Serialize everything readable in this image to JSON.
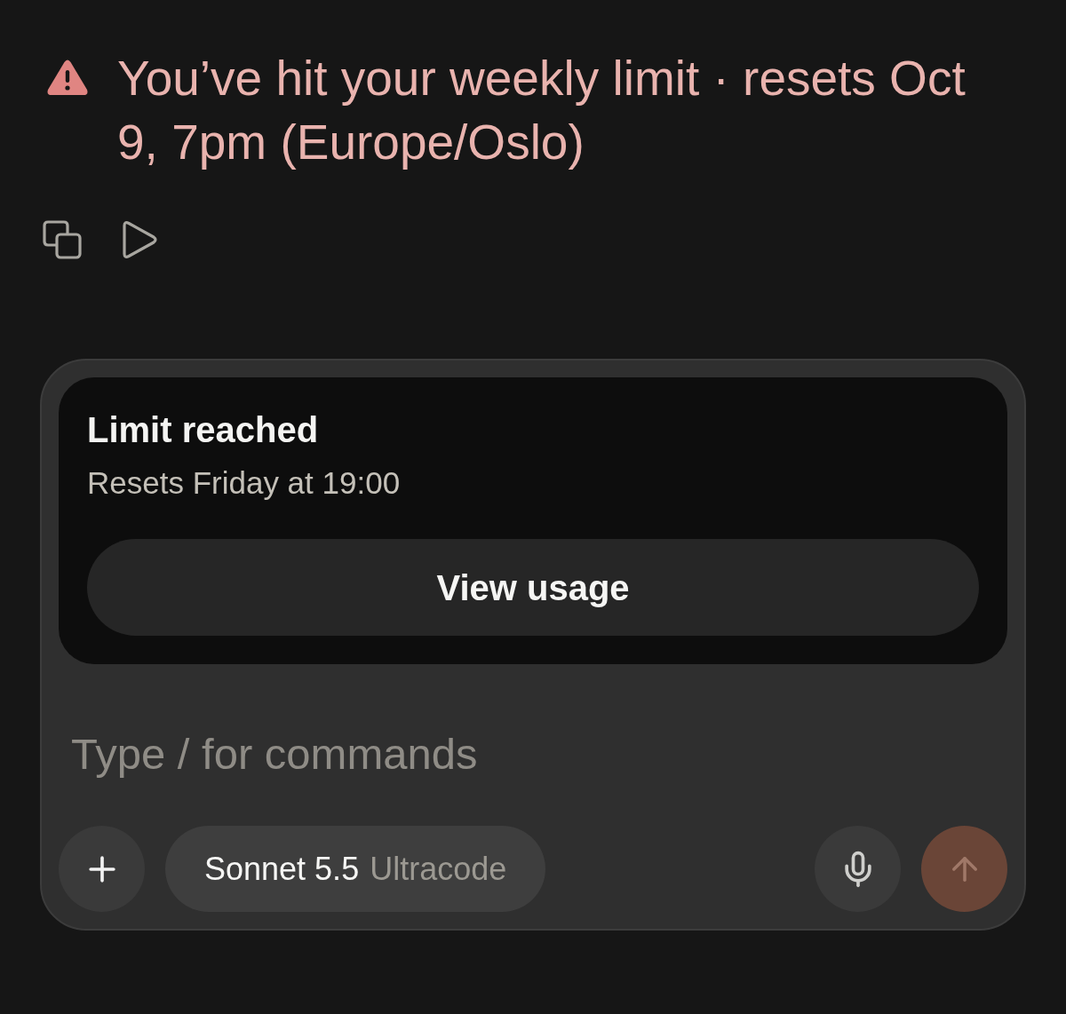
{
  "alert": {
    "message": "You’ve hit your weekly limit · resets Oct 9, 7pm (Europe/Oslo)"
  },
  "message_actions": [
    {
      "kind": "copy"
    },
    {
      "kind": "retry"
    }
  ],
  "composer": {
    "limit_card": {
      "title": "Limit reached",
      "subtitle": "Resets Friday at 19:00",
      "button": "View usage"
    },
    "input": {
      "placeholder": "Type / for commands"
    },
    "model_selector": {
      "model": "Sonnet 5.5",
      "mode": "Ultracode"
    },
    "send_button": {
      "disabled": true
    }
  }
}
